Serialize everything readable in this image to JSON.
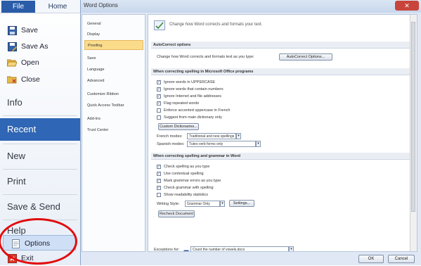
{
  "backstage": {
    "tabs": {
      "file": "File",
      "home": "Home"
    },
    "items_small": [
      {
        "label": "Save",
        "icon": "save-icon"
      },
      {
        "label": "Save As",
        "icon": "save-as-icon"
      },
      {
        "label": "Open",
        "icon": "folder-open-icon"
      },
      {
        "label": "Close",
        "icon": "folder-close-icon"
      }
    ],
    "info": "Info",
    "recent": "Recent",
    "new": "New",
    "print": "Print",
    "save_send": "Save & Send",
    "help": "Help",
    "options": "Options",
    "exit": "Exit",
    "accent": "#2f66b5",
    "highlight_color": "#e10d0d"
  },
  "dialog": {
    "title": "Word Options",
    "close": "✕",
    "nav": [
      {
        "label": "General"
      },
      {
        "label": "Display"
      },
      {
        "label": "Proofing",
        "selected": true
      },
      {
        "label": "Save"
      },
      {
        "label": "Language"
      },
      {
        "label": "Advanced"
      },
      {
        "label": "Customize Ribbon"
      },
      {
        "label": "Quick Access Toolbar"
      },
      {
        "label": "Add-Ins"
      },
      {
        "label": "Trust Center"
      }
    ],
    "header": "Change how Word corrects and formats your text.",
    "sections": {
      "autocorrect": "AutoCorrect options",
      "office": "When correcting spelling in Microsoft Office programs",
      "word": "When correcting spelling and grammar in Word"
    },
    "autocorrect_text": "Change how Word corrects and formats text as you type:",
    "autocorrect_button": "AutoCorrect Options...",
    "office_options": [
      {
        "label": "Ignore words in UPPERCASE",
        "checked": true
      },
      {
        "label": "Ignore words that contain numbers",
        "checked": true
      },
      {
        "label": "Ignore Internet and file addresses",
        "checked": true
      },
      {
        "label": "Flag repeated words",
        "checked": true
      },
      {
        "label": "Enforce accented uppercase in French",
        "checked": false
      },
      {
        "label": "Suggest from main dictionary only",
        "checked": false
      }
    ],
    "custom_dict_button": "Custom Dictionaries...",
    "french_modes_label": "French modes:",
    "french_modes_value": "Traditional and new spellings",
    "spanish_modes_label": "Spanish modes:",
    "spanish_modes_value": "Tuteo verb forms only",
    "word_options": [
      {
        "label": "Check spelling as you type",
        "checked": true
      },
      {
        "label": "Use contextual spelling",
        "checked": true
      },
      {
        "label": "Mark grammar errors as you type",
        "checked": true
      },
      {
        "label": "Check grammar with spelling",
        "checked": true
      },
      {
        "label": "Show readability statistics",
        "checked": false
      }
    ],
    "writing_style_label": "Writing Style:",
    "writing_style_value": "Grammar Only",
    "settings_button": "Settings...",
    "recheck_button": "Recheck Document",
    "exceptions_label": "Exceptions for:",
    "exceptions_value": "Count the number of vowels.docx",
    "ok": "OK",
    "cancel": "Cancel"
  }
}
